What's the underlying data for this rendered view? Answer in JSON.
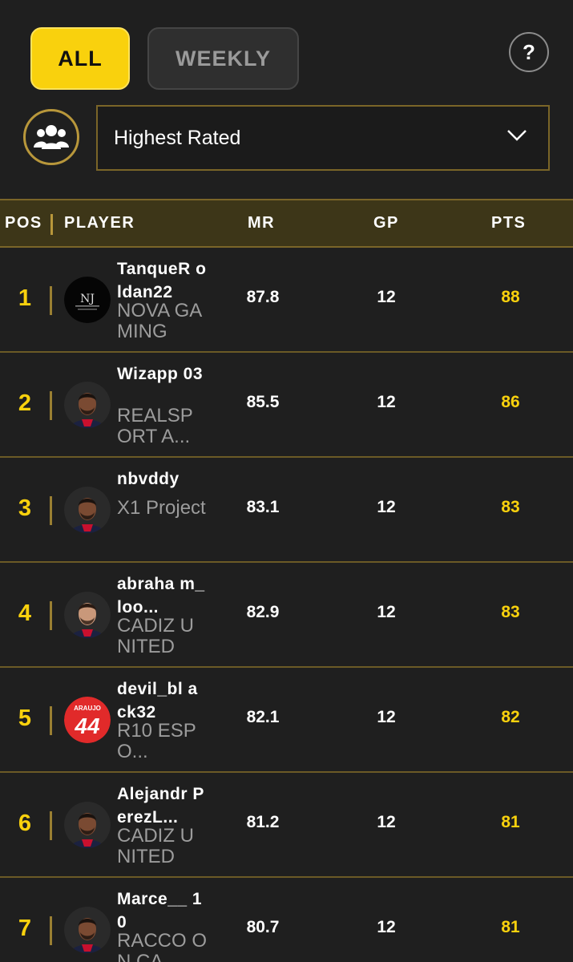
{
  "tabs": {
    "all": "ALL",
    "weekly": "WEEKLY"
  },
  "help_label": "?",
  "filter": {
    "selected": "Highest Rated"
  },
  "table": {
    "headers": {
      "pos": "POS",
      "player": "PLAYER",
      "mr": "MR",
      "gp": "GP",
      "pts": "PTS"
    },
    "rows": [
      {
        "pos": "1",
        "name": "TanqueR oldan22",
        "club": "NOVA GAMING",
        "mr": "87.8",
        "gp": "12",
        "pts": "88",
        "avatar": "logo"
      },
      {
        "pos": "2",
        "name": "Wizapp 03",
        "club": "REALSP ORT A...",
        "mr": "85.5",
        "gp": "12",
        "pts": "86",
        "avatar": "player-face"
      },
      {
        "pos": "3",
        "name": "nbvddy",
        "club": "X1 Project",
        "mr": "83.1",
        "gp": "12",
        "pts": "83",
        "avatar": "player-face"
      },
      {
        "pos": "4",
        "name": "abraha m_loo...",
        "club": "CADIZ UNITED",
        "mr": "82.9",
        "gp": "12",
        "pts": "83",
        "avatar": "player-face-light"
      },
      {
        "pos": "5",
        "name": "devil_bl ack32",
        "club": "R10 ESPO...",
        "mr": "82.1",
        "gp": "12",
        "pts": "82",
        "avatar": "jersey"
      },
      {
        "pos": "6",
        "name": "Alejandr PerezL...",
        "club": "CADIZ UNITED",
        "mr": "81.2",
        "gp": "12",
        "pts": "81",
        "avatar": "player-face"
      },
      {
        "pos": "7",
        "name": "Marce__ 10",
        "club": "RACCO ON CA...",
        "mr": "80.7",
        "gp": "12",
        "pts": "81",
        "avatar": "player-face"
      }
    ]
  },
  "jersey": {
    "name": "ARAUJO",
    "number": "44"
  },
  "colors": {
    "accent": "#f9d10d",
    "header_bg": "#3d3618",
    "background": "#1f1f1f"
  }
}
